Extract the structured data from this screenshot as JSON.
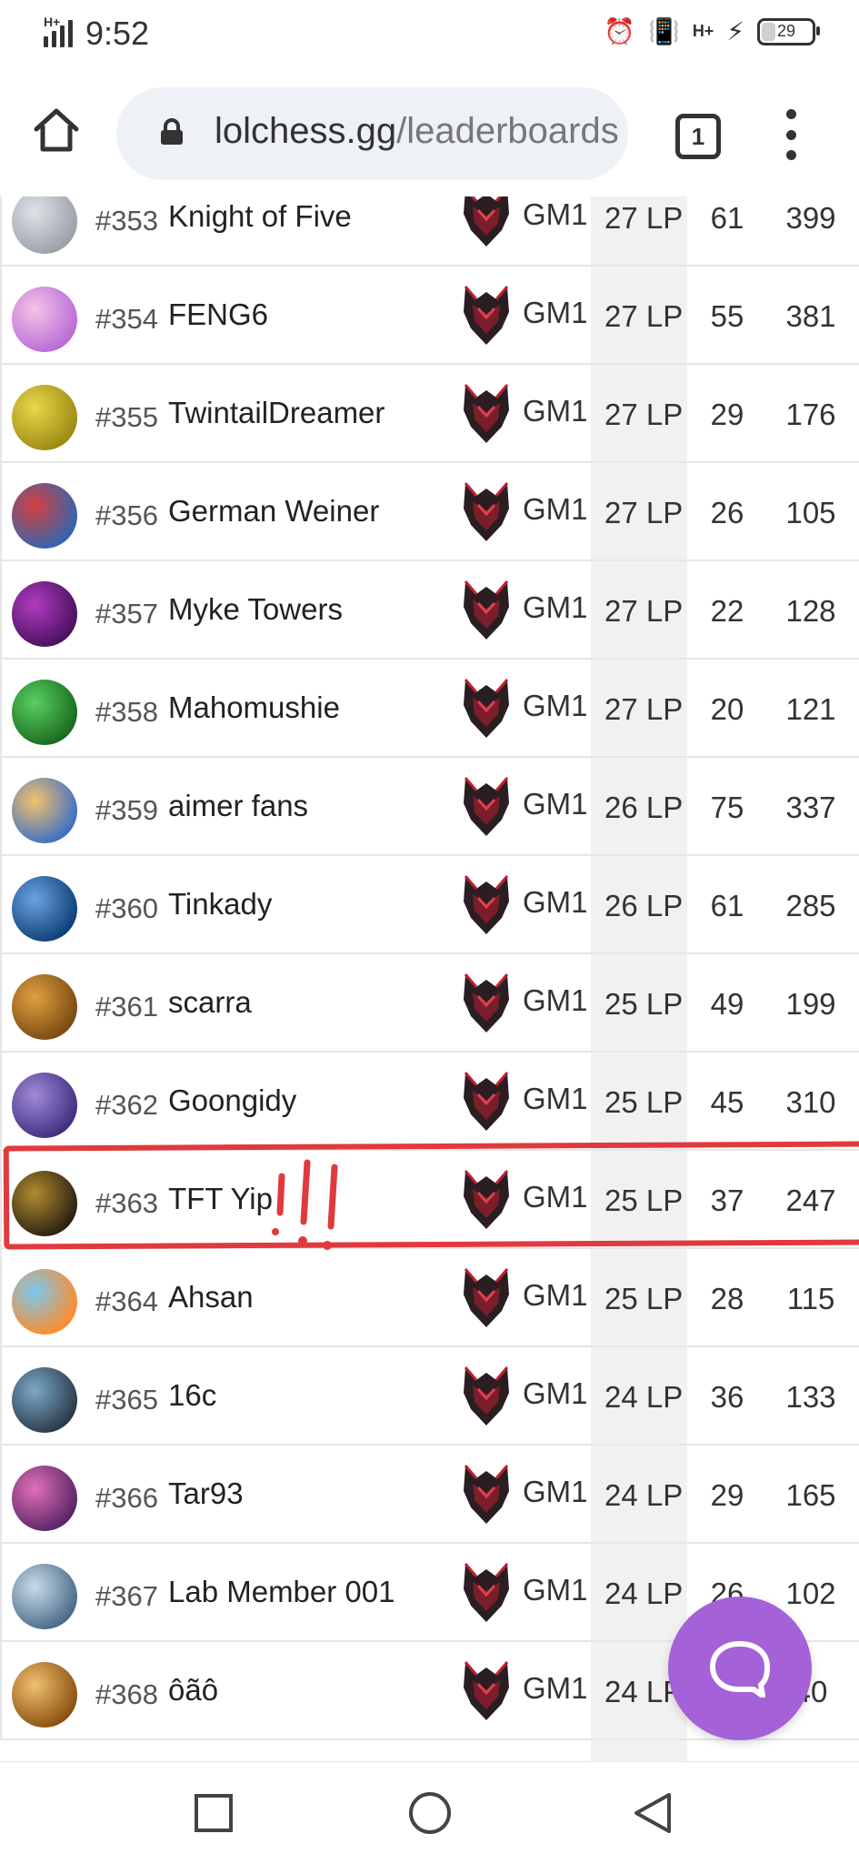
{
  "status_bar": {
    "network": "H+",
    "time": "9:52",
    "data_type": "H+",
    "battery": "29"
  },
  "browser": {
    "url_main": "lolchess.gg",
    "url_rest": "/leaderboards",
    "tab_count": "1"
  },
  "colors": {
    "highlight": "#e0393e",
    "fab": "#a461d8",
    "lp_column": "#f1f1f1"
  },
  "rows": [
    {
      "rank": "#353",
      "name": "Knight of Five",
      "tier": "GM1",
      "lp": "27 LP",
      "wins": "61",
      "played": "399",
      "avatar_icon": "silver-sword-avatar-icon"
    },
    {
      "rank": "#354",
      "name": "FENG6",
      "tier": "GM1",
      "lp": "27 LP",
      "wins": "55",
      "played": "381",
      "avatar_icon": "purple-hair-avatar-icon"
    },
    {
      "rank": "#355",
      "name": "TwintailDreamer",
      "tier": "GM1",
      "lp": "27 LP",
      "wins": "29",
      "played": "176",
      "avatar_icon": "sprout-avatar-icon"
    },
    {
      "rank": "#356",
      "name": "German Weiner",
      "tier": "GM1",
      "lp": "27 LP",
      "wins": "26",
      "played": "105",
      "avatar_icon": "monster-santa-avatar-icon"
    },
    {
      "rank": "#357",
      "name": "Myke Towers",
      "tier": "GM1",
      "lp": "27 LP",
      "wins": "22",
      "played": "128",
      "avatar_icon": "dark-mage-avatar-icon"
    },
    {
      "rank": "#358",
      "name": "Mahomushie",
      "tier": "GM1",
      "lp": "27 LP",
      "wins": "20",
      "played": "121",
      "avatar_icon": "green-figure-avatar-icon"
    },
    {
      "rank": "#359",
      "name": "aimer fans",
      "tier": "GM1",
      "lp": "26 LP",
      "wins": "75",
      "played": "337",
      "avatar_icon": "yordle-avatar-icon"
    },
    {
      "rank": "#360",
      "name": "Tinkady",
      "tier": "GM1",
      "lp": "26 LP",
      "wins": "61",
      "played": "285",
      "avatar_icon": "blue-crest-avatar-icon"
    },
    {
      "rank": "#361",
      "name": "scarra",
      "tier": "GM1",
      "lp": "25 LP",
      "wins": "49",
      "played": "199",
      "avatar_icon": "golden-gear-avatar-icon"
    },
    {
      "rank": "#362",
      "name": "Goongidy",
      "tier": "GM1",
      "lp": "25 LP",
      "wins": "45",
      "played": "310",
      "avatar_icon": "dragon-avatar-icon"
    },
    {
      "rank": "#363",
      "name": "TFT Yip",
      "tier": "GM1",
      "lp": "25 LP",
      "wins": "37",
      "played": "247",
      "avatar_icon": "golden-lamp-avatar-icon"
    },
    {
      "rank": "#364",
      "name": "Ahsan",
      "tier": "GM1",
      "lp": "25 LP",
      "wins": "28",
      "played": "115",
      "avatar_icon": "penguin-avatar-icon"
    },
    {
      "rank": "#365",
      "name": "16c",
      "tier": "GM1",
      "lp": "24 LP",
      "wins": "36",
      "played": "133",
      "avatar_icon": "hooded-figure-avatar-icon"
    },
    {
      "rank": "#366",
      "name": "Tar93",
      "tier": "GM1",
      "lp": "24 LP",
      "wins": "29",
      "played": "165",
      "avatar_icon": "pink-girl-avatar-icon"
    },
    {
      "rank": "#367",
      "name": "Lab Member 001",
      "tier": "GM1",
      "lp": "24 LP",
      "wins": "26",
      "played": "102",
      "avatar_icon": "robot-girl-avatar-icon"
    },
    {
      "rank": "#368",
      "name": "ôãô",
      "tier": "GM1",
      "lp": "24 LP",
      "wins": "",
      "played": "40",
      "avatar_icon": "golden-hair-avatar-icon"
    }
  ]
}
